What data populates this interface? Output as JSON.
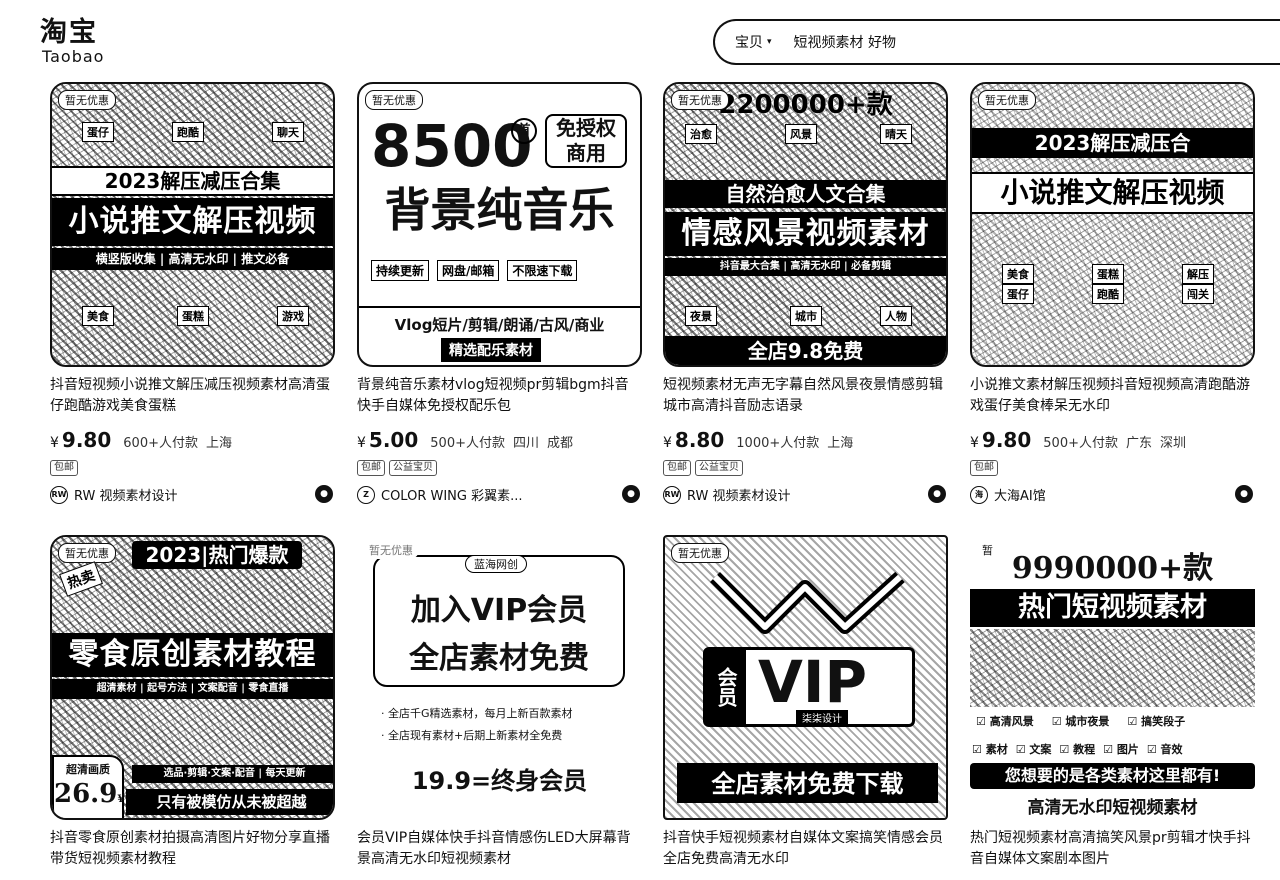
{
  "header": {
    "logo_cn": "淘宝",
    "logo_en": "Taobao",
    "search_type": "宝贝",
    "search_query": "短视频素材 好物"
  },
  "products": [
    {
      "title": "抖音短视频小说推文解压减压视频素材高清蛋仔跑酷游戏美食蛋糕",
      "price": "9.80",
      "sold": "600+人付款",
      "location": [
        "上海"
      ],
      "tags": [
        "包邮"
      ],
      "shop_logo": "RW",
      "shop": "RW 视频素材设计",
      "thumb": {
        "promo": "暂无优惠",
        "year": "2023解压减压合集",
        "headline": "小说推文解压视频",
        "sub": "横竖版收集 | 高清无水印 | 推文必备",
        "labels": [
          "蛋仔",
          "跑酷",
          "聊天",
          "美食",
          "蛋糕",
          "游戏"
        ]
      }
    },
    {
      "title": "背景纯音乐素材vlog短视频pr剪辑bgm抖音快手自媒体免授权配乐包",
      "price": "5.00",
      "sold": "500+人付款",
      "location": [
        "四川",
        "成都"
      ],
      "tags": [
        "包邮",
        "公益宝贝"
      ],
      "shop_logo": "Z",
      "shop": "COLOR WING 彩翼素...",
      "thumb": {
        "promo": "暂无优惠",
        "number": "8500",
        "unit": "首",
        "license": "免授权商用",
        "headline": "背景纯音乐",
        "badges": [
          "持续更新",
          "网盘/邮箱",
          "不限速下载"
        ],
        "types": "Vlog短片/剪辑/朗诵/古风/商业",
        "footer": "精选配乐素材"
      }
    },
    {
      "title": "短视频素材无声无字幕自然风景夜景情感剪辑城市高清抖音励志语录",
      "price": "8.80",
      "sold": "1000+人付款",
      "location": [
        "上海"
      ],
      "tags": [
        "包邮",
        "公益宝贝"
      ],
      "shop_logo": "RW",
      "shop": "RW 视频素材设计",
      "thumb": {
        "promo": "暂无优惠",
        "number": "2200000+款",
        "labels": [
          "治愈",
          "风景",
          "晴天"
        ],
        "sub1": "自然治愈人文合集",
        "headline": "情感风景视频素材",
        "sub2": "抖音最大合集 | 高清无水印 | 必备剪辑",
        "labels2": [
          "夜景",
          "城市",
          "人物"
        ],
        "footer": "全店9.8免费"
      }
    },
    {
      "title": "小说推文素材解压视频抖音短视频高清跑酷游戏蛋仔美食棒呆无水印",
      "price": "9.80",
      "sold": "500+人付款",
      "location": [
        "广东",
        "深圳"
      ],
      "tags": [
        "包邮"
      ],
      "shop_logo": "海",
      "shop": "大海AI馆",
      "thumb": {
        "promo": "暂无优惠",
        "year": "2023解压减压合",
        "headline": "小说推文解压视频",
        "checks": [
          "美食",
          "蛋糕",
          "解压",
          "蛋仔",
          "跑酷",
          "闯关"
        ]
      }
    },
    {
      "title": "抖音零食原创素材拍摄高清图片好物分享直播带货短视频素材教程",
      "price": "",
      "sold": "",
      "location": [],
      "tags": [],
      "shop_logo": "",
      "shop": "",
      "thumb": {
        "promo": "暂无优惠",
        "year": "2023|热门爆款",
        "corner": "热卖",
        "headline": "零食原创素材教程",
        "sub": "超清素材 | 起号方法 | 文案配音 | 零食直播",
        "quality": "超清画质",
        "price": "26.9",
        "yen": "¥",
        "strip1": "选品·剪辑·文案·配音 | 每天更新",
        "strip2": "只有被模仿从未被超越"
      }
    },
    {
      "title": "会员VIP自媒体快手抖音情感伤LED大屏幕背景高清无水印短视频素材",
      "price": "",
      "sold": "",
      "location": [],
      "tags": [],
      "shop_logo": "",
      "shop": "",
      "thumb": {
        "promo": "暂无优惠",
        "brand": "蓝海网创",
        "line1": "加入VIP会员",
        "line2": "全店素材免费",
        "bullet1": "· 全店千G精选素材，每月上新百款素材",
        "bullet2": "· 全店现有素材+后期上新素材全免费",
        "footer": "19.9=终身会员"
      }
    },
    {
      "title": "抖音快手短视频素材自媒体文案搞笑情感会员全店免费高清无水印",
      "price": "",
      "sold": "",
      "location": [],
      "tags": [],
      "shop_logo": "",
      "shop": "",
      "thumb": {
        "promo": "暂无优惠",
        "member": "会员",
        "vip": "VIP",
        "design": "柒柒设计",
        "footer": "全店素材免费下载"
      }
    },
    {
      "title": "热门短视频素材高清搞笑风景pr剪辑才快手抖音自媒体文案剧本图片",
      "price": "",
      "sold": "",
      "location": [],
      "tags": [],
      "shop_logo": "",
      "shop": "",
      "thumb": {
        "promo": "暂",
        "number": "9990000+款",
        "headline": "热门短视频素材",
        "checks1": [
          "高清风景",
          "城市夜景",
          "搞笑段子"
        ],
        "checks2": [
          "素材",
          "文案",
          "教程",
          "图片",
          "音效"
        ],
        "slogan": "您想要的是各类素材这里都有!",
        "footer": "高清无水印短视频素材"
      }
    }
  ]
}
